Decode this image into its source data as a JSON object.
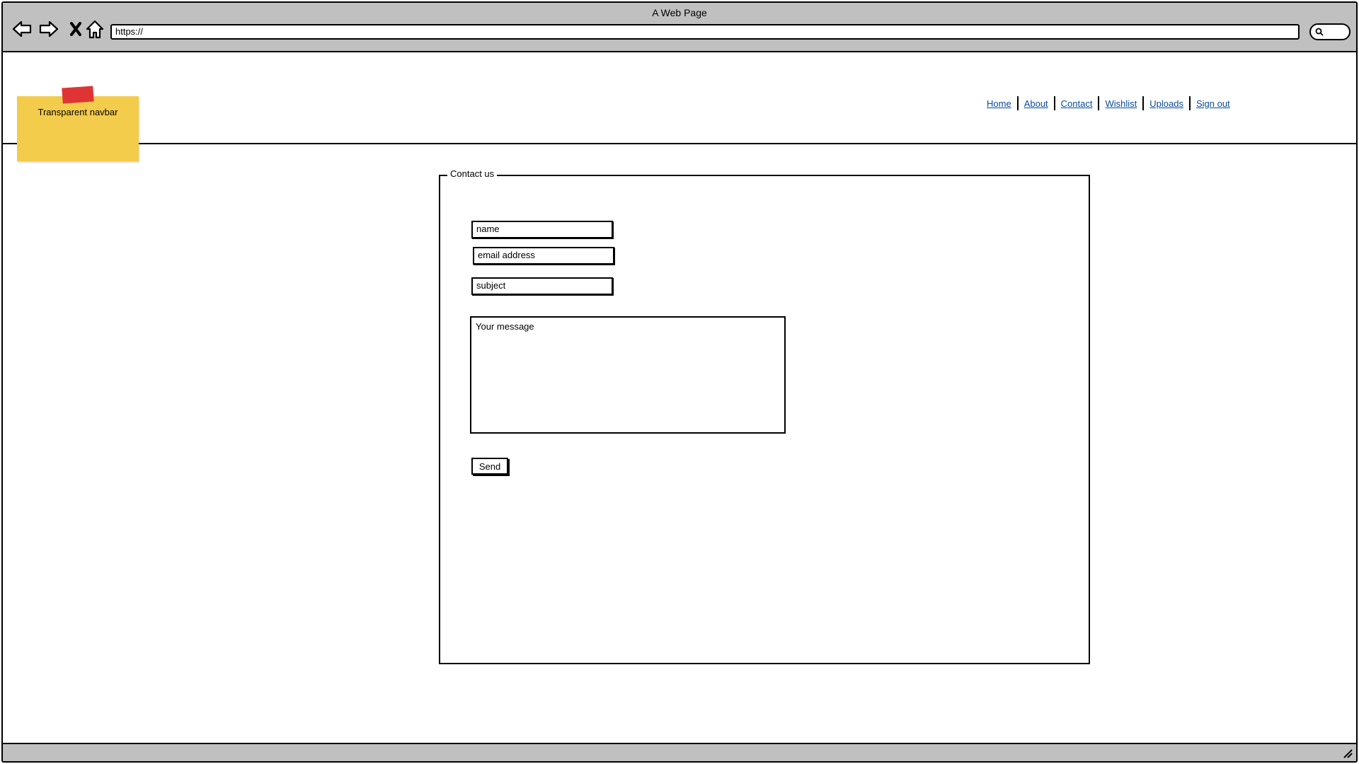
{
  "window": {
    "title": "A Web Page"
  },
  "browser": {
    "url": "https://",
    "icons": [
      "back-arrow-icon",
      "forward-arrow-icon",
      "close-x-icon",
      "home-icon",
      "search-icon",
      "resize-grip-icon"
    ]
  },
  "header": {
    "sticky_note": "Transparent navbar",
    "nav": [
      "Home",
      "About",
      "Contact",
      "Wishlist",
      "Uploads",
      "Sign out"
    ]
  },
  "contact": {
    "legend": "Contact us",
    "fields": {
      "name": "name",
      "email": "email address",
      "subject": "subject",
      "message": "Your message"
    },
    "send_label": "Send"
  },
  "colors": {
    "chrome": "#c0c0c0",
    "link": "#0a4b9a",
    "sticky": "#f4cc4c",
    "tape": "#e03434"
  }
}
